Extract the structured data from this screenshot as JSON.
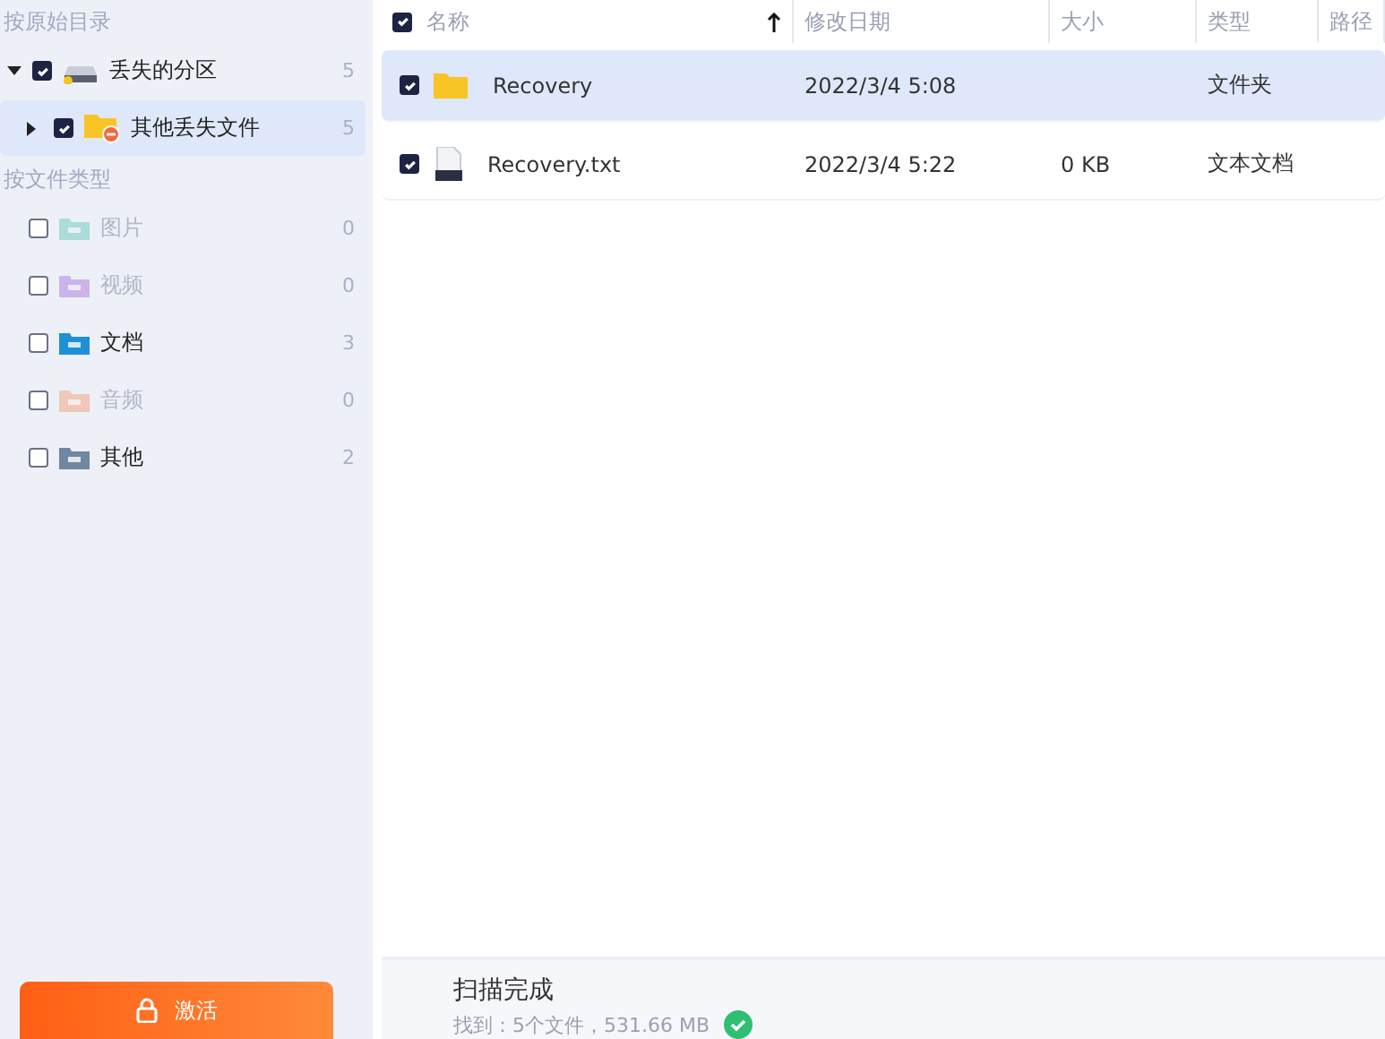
{
  "sidebar": {
    "tree_heading": "按原始目录",
    "tree": [
      {
        "label": "丢失的分区",
        "count": "5",
        "checked": true,
        "expanded": true,
        "selected": false,
        "kind": "drive",
        "children": [
          {
            "label": "其他丢失文件",
            "count": "5",
            "checked": true,
            "expanded": false,
            "selected": true,
            "kind": "lost-folder"
          }
        ]
      }
    ],
    "types_heading": "按文件类型",
    "types": [
      {
        "label": "图片",
        "count": "0",
        "checked": false,
        "disabled": true,
        "kind": "image"
      },
      {
        "label": "视频",
        "count": "0",
        "checked": false,
        "disabled": true,
        "kind": "video"
      },
      {
        "label": "文档",
        "count": "3",
        "checked": false,
        "disabled": false,
        "kind": "document"
      },
      {
        "label": "音频",
        "count": "0",
        "checked": false,
        "disabled": true,
        "kind": "audio"
      },
      {
        "label": "其他",
        "count": "2",
        "checked": false,
        "disabled": false,
        "kind": "other"
      }
    ],
    "activate_button": "激活"
  },
  "table": {
    "all_checked": true,
    "columns": [
      {
        "label": "名称",
        "sorted": true
      },
      {
        "label": "修改日期",
        "sorted": false
      },
      {
        "label": "大小",
        "sorted": false
      },
      {
        "label": "类型",
        "sorted": false
      },
      {
        "label": "路径",
        "sorted": false
      }
    ],
    "rows": [
      {
        "name": "Recovery",
        "date": "2022/3/4 5:08",
        "size": "",
        "type": "文件夹",
        "kind": "folder",
        "checked": true,
        "selected": true
      },
      {
        "name": "Recovery.txt",
        "date": "2022/3/4 5:22",
        "size": "0 KB",
        "type": "文本文档",
        "kind": "txt",
        "checked": true,
        "selected": false
      }
    ]
  },
  "status": {
    "title": "扫描完成",
    "summary": "找到：5个文件，531.66 MB",
    "done": true
  }
}
